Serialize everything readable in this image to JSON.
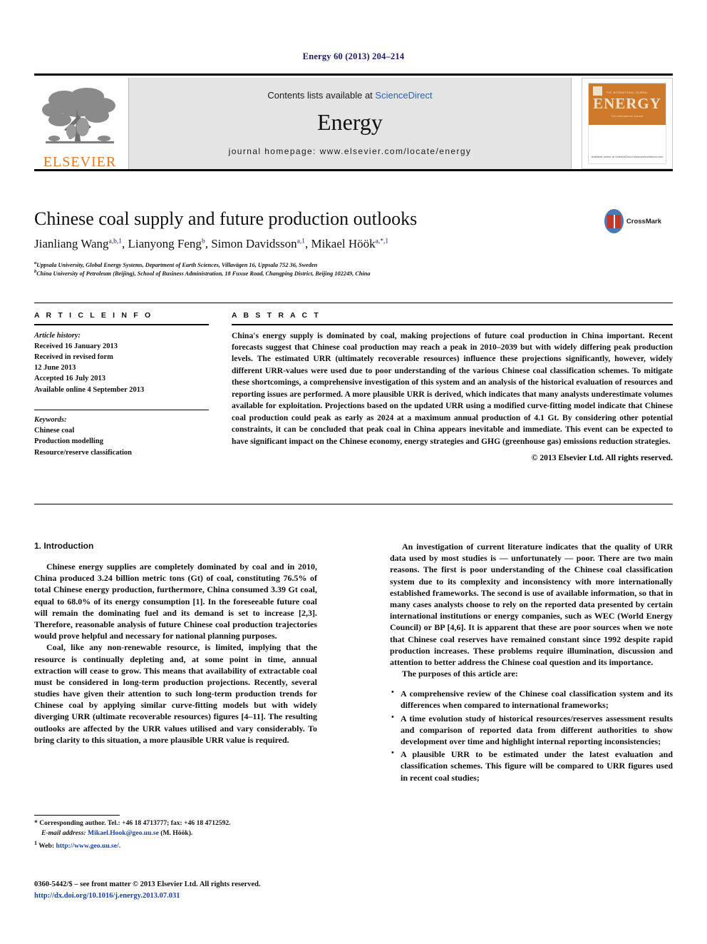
{
  "running_head": "Energy 60 (2013) 204–214",
  "masthead": {
    "contents_prefix": "Contents lists available at ",
    "sciencedirect": "ScienceDirect",
    "journal_title": "Energy",
    "homepage": "journal homepage: www.elsevier.com/locate/energy",
    "publisher_logo_text": "ELSEVIER",
    "cover": {
      "title": "ENERGY",
      "top_labels": "THE INTERNATIONAL JOURNAL",
      "subtitle": "The international Journal",
      "footer": "Available online at\nScienceDirect\nwww.sciencedirect.com"
    }
  },
  "article": {
    "title": "Chinese coal supply and future production outlooks",
    "authors": "Jianliang Wang, Lianyong Feng, Simon Davidsson, Mikael Höök",
    "author_marks": {
      "wang": "a,b,1",
      "feng": "b",
      "davidsson": "a,1",
      "hook": "a,*,1"
    },
    "affiliation_a_sup": "a",
    "affiliation_a": "Uppsala University, Global Energy Systems, Department of Earth Sciences, Villavägen 16, Uppsala 752 36, Sweden",
    "affiliation_b_sup": "b",
    "affiliation_b": "China University of Petroleum (Beijing), School of Business Administration, 18 Fuxue Road, Changping District, Beijing 102249, China",
    "crossmark_label": "CrossMark"
  },
  "article_info": {
    "heading": "A R T I C L E   I N F O",
    "history_label": "Article history:",
    "history": [
      "Received 16 January 2013",
      "Received in revised form",
      "12 June 2013",
      "Accepted 16 July 2013",
      "Available online 4 September 2013"
    ],
    "keywords_label": "Keywords:",
    "keywords": [
      "Chinese coal",
      "Production modelling",
      "Resource/reserve classification"
    ]
  },
  "abstract": {
    "heading": "A B S T R A C T",
    "text": "China's energy supply is dominated by coal, making projections of future coal production in China important. Recent forecasts suggest that Chinese coal production may reach a peak in 2010–2039 but with widely differing peak production levels. The estimated URR (ultimately recoverable resources) influence these projections significantly, however, widely different URR-values were used due to poor understanding of the various Chinese coal classification schemes. To mitigate these shortcomings, a comprehensive investigation of this system and an analysis of the historical evaluation of resources and reporting issues are performed. A more plausible URR is derived, which indicates that many analysts underestimate volumes available for exploitation. Projections based on the updated URR using a modified curve-fitting model indicate that Chinese coal production could peak as early as 2024 at a maximum annual production of 4.1 Gt. By considering other potential constraints, it can be concluded that peak coal in China appears inevitable and immediate. This event can be expected to have significant impact on the Chinese economy, energy strategies and GHG (greenhouse gas) emissions reduction strategies.",
    "copyright": "© 2013 Elsevier Ltd. All rights reserved."
  },
  "body": {
    "section_heading": "1. Introduction",
    "left_paragraphs": [
      "Chinese energy supplies are completely dominated by coal and in 2010, China produced 3.24 billion metric tons (Gt) of coal, constituting 76.5% of total Chinese energy production, furthermore, China consumed 3.39 Gt coal, equal to 68.0% of its energy consumption [1]. In the foreseeable future coal will remain the dominating fuel and its demand is set to increase [2,3]. Therefore, reasonable analysis of future Chinese coal production trajectories would prove helpful and necessary for national planning purposes.",
      "Coal, like any non-renewable resource, is limited, implying that the resource is continually depleting and, at some point in time, annual extraction will cease to grow. This means that availability of extractable coal must be considered in long-term production projections. Recently, several studies have given their attention to such long-term production trends for Chinese coal by applying similar curve-fitting models but with widely diverging URR (ultimate recoverable resources) figures [4–11]. The resulting outlooks are affected by the URR values utilised and vary considerably. To bring clarity to this situation, a more plausible URR value is required."
    ],
    "right_paragraphs": [
      "An investigation of current literature indicates that the quality of URR data used by most studies is — unfortunately — poor. There are two main reasons. The first is poor understanding of the Chinese coal classification system due to its complexity and inconsistency with more internationally established frameworks. The second is use of available information, so that in many cases analysts choose to rely on the reported data presented by certain international institutions or energy companies, such as WEC (World Energy Council) or BP [4,6]. It is apparent that these are poor sources when we note that Chinese coal reserves have remained constant since 1992 despite rapid production increases. These problems require illumination, discussion and attention to better address the Chinese coal question and its importance.",
      "The purposes of this article are:"
    ],
    "bullets": [
      "A comprehensive review of the Chinese coal classification system and its differences when compared to international frameworks;",
      "A time evolution study of historical resources/reserves assessment results and comparison of reported data from different authorities to show development over time and highlight internal reporting inconsistencies;",
      "A plausible URR to be estimated under the latest evaluation and classification schemes. This figure will be compared to URR figures used in recent coal studies;"
    ]
  },
  "footnotes": {
    "corresponding": "* Corresponding author. Tel.: +46 18 4713777; fax: +46 18 4712592.",
    "email_label": "E-mail address:",
    "email": "Mikael.Hook@geo.uu.se",
    "email_suffix": " (M. Höök).",
    "web_marker": "1",
    "web_label": "Web: ",
    "web_url": "http://www.geo.uu.se/."
  },
  "imprint": {
    "line1": "0360-5442/$ – see front matter © 2013 Elsevier Ltd. All rights reserved.",
    "doi": "http://dx.doi.org/10.1016/j.energy.2013.07.031"
  },
  "colors": {
    "link": "#1a3faa",
    "sciencedirect": "#2d62b3",
    "elsevier_orange": "#E87722",
    "runhead": "#1a1a6e"
  }
}
